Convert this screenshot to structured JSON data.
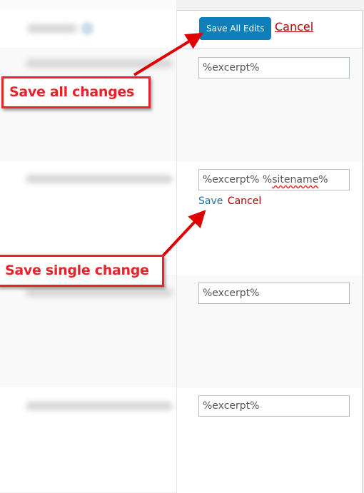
{
  "header": {
    "save_all_label": "Save All Edits",
    "cancel_all_label": "Cancel"
  },
  "rows": [
    {
      "value": "%excerpt%"
    },
    {
      "value_plain": "%excerpt% %",
      "value_misspelled": "sitename",
      "value_suffix": "%",
      "save_label": "Save",
      "cancel_label": "Cancel"
    },
    {
      "value": "%excerpt%"
    },
    {
      "value": "%excerpt%"
    }
  ],
  "annotations": {
    "save_all": "Save all changes",
    "save_single": "Save single change"
  },
  "colors": {
    "primary_button": "#0f7fba",
    "cancel_link": "#aa0000",
    "save_link": "#1e6fa5",
    "annotation_red": "#e8232a",
    "row_alt_bg": "#f9f9f9"
  }
}
